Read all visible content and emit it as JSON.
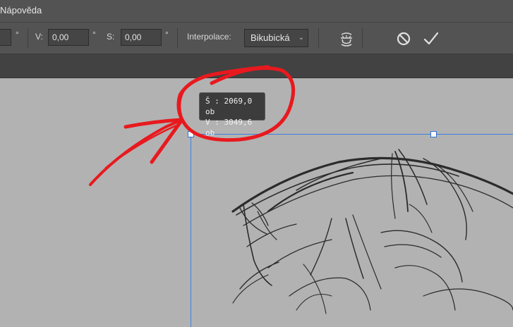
{
  "menubar": {
    "menu_help": "Nápověda"
  },
  "options": {
    "width_value": "",
    "degree_symbol": "°",
    "v_label": "V:",
    "v_value": "0,00",
    "s_label": "S:",
    "s_value": "0,00",
    "interpolation_label": "Interpolace:",
    "interpolation_value": "Bikubická",
    "warp_icon": "warp-icon",
    "cancel_icon": "cancel-icon",
    "commit_icon": "check-icon"
  },
  "tooltip": {
    "width_line": "Š : 2069,0 ob",
    "height_line": "V : 3049,6 ob"
  },
  "colors": {
    "annotation": "#e8191e",
    "bbox": "#3c7ee0"
  }
}
